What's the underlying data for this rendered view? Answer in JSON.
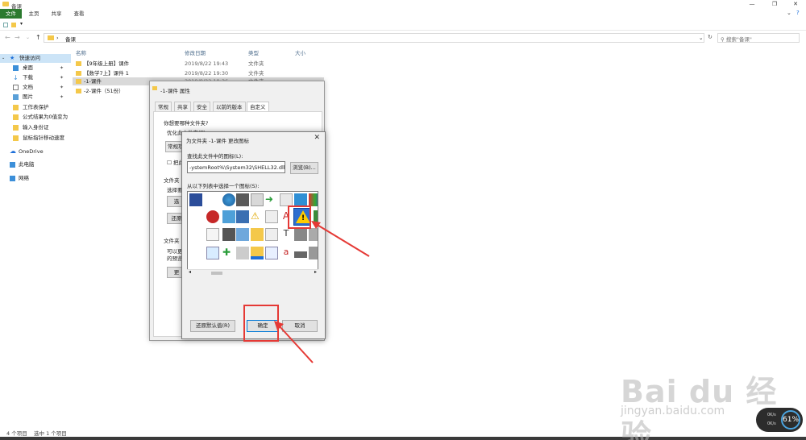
{
  "window": {
    "title": "备课"
  },
  "ribbon": {
    "tabs": [
      "文件",
      "主页",
      "共享",
      "查看"
    ]
  },
  "address": {
    "path": "备课",
    "search_placeholder": "搜索\"备课\""
  },
  "sidebar": {
    "items": [
      {
        "label": "快速访问",
        "pin": ""
      },
      {
        "label": "桌面",
        "pin": "✦"
      },
      {
        "label": "下载",
        "pin": "✦"
      },
      {
        "label": "文档",
        "pin": "✦"
      },
      {
        "label": "图片",
        "pin": "✦"
      },
      {
        "label": "工作表保护",
        "pin": ""
      },
      {
        "label": "公式结果为0值变为",
        "pin": ""
      },
      {
        "label": "输入身份证",
        "pin": ""
      },
      {
        "label": "鼠标指针移动速度",
        "pin": ""
      },
      {
        "label": "OneDrive",
        "pin": ""
      },
      {
        "label": "此电脑",
        "pin": ""
      },
      {
        "label": "网络",
        "pin": ""
      }
    ]
  },
  "file_list": {
    "headers": {
      "name": "名称",
      "modified": "修改日期",
      "type": "类型",
      "size": "大小"
    },
    "rows": [
      {
        "name": "【9年级上册】课件",
        "modified": "2019/8/22 19:43",
        "type": "文件夹"
      },
      {
        "name": "【数学7上】课件 1",
        "modified": "2019/8/22 19:30",
        "type": "文件夹"
      },
      {
        "name": "-1-课件",
        "modified": "2019/8/22 19:36",
        "type": "文件夹"
      },
      {
        "name": "-2-课件（51份）",
        "modified": "",
        "type": ""
      }
    ]
  },
  "status": {
    "items": "4 个项目",
    "selected": "选中 1 个项目"
  },
  "properties": {
    "title": "-1-课件 属性",
    "tabs": [
      "常规",
      "共享",
      "安全",
      "以前的版本",
      "自定义"
    ],
    "q1": "你想要哪种文件夹?",
    "optimize": "优化此文件夹(T):",
    "optimize_value": "常规项",
    "apply_sub": "把此",
    "folder_pic": "文件夹",
    "choose": "选择要",
    "choose_btn": "选",
    "restore_btn": "还原",
    "folder_icon": "文件夹",
    "desc1": "可以更改",
    "desc2": "的预览。",
    "change_btn": "更"
  },
  "icon_dialog": {
    "title": "为文件夹 -1-课件 更改图标",
    "find_label": "查找此文件中的图标(L):",
    "path_value": "-ystemRoot%\\System32\\SHELL32.dll",
    "browse": "浏览(B)...",
    "pick_label": "从以下列表中选择一个图标(S):",
    "restore": "还原默认值(R)",
    "ok": "确定",
    "cancel": "取消"
  },
  "watermark": {
    "main": "Bai du 经验",
    "sub": "jingyan.baidu.com"
  },
  "net_widget": {
    "percent": "61%",
    "up": "0K/s",
    "down": "0K/s"
  },
  "colors": {
    "file_tab": "#2b7a2e",
    "selection": "#cce4f7",
    "highlight": "#e53935"
  }
}
